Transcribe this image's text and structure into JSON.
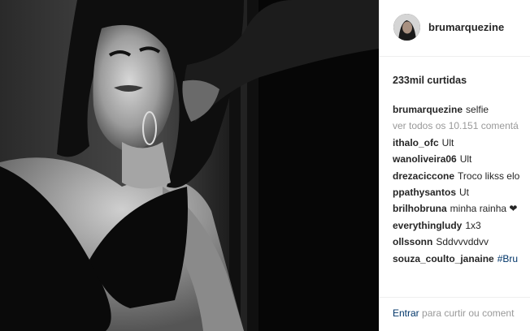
{
  "post": {
    "author": "brumarquezine",
    "likes_label": "233mil curtidas"
  },
  "comments": [
    {
      "user": "brumarquezine",
      "text": "selfie"
    },
    {
      "user": "",
      "text": "ver todos os 10.151 comentá"
    },
    {
      "user": "ithalo_ofc",
      "text": "Ult"
    },
    {
      "user": "wanoliveira06",
      "text": "Ult"
    },
    {
      "user": "drezaciccone",
      "text": "Troco likss elo"
    },
    {
      "user": "ppathysantos",
      "text": "Ut"
    },
    {
      "user": "brilhobruna",
      "text": "minha rainha ❤"
    },
    {
      "user": "everythingludy",
      "text": "1x3"
    },
    {
      "user": "ollssonn",
      "text": "Sddvvvddvv"
    },
    {
      "user": "souza_coulto_janaine",
      "text": "#Bru"
    }
  ],
  "footer": {
    "login_link": "Entrar",
    "rest": "para curtir ou coment"
  },
  "colors": {
    "text": "#262626",
    "muted": "#999999",
    "link": "#003569",
    "divider": "#efefef"
  }
}
